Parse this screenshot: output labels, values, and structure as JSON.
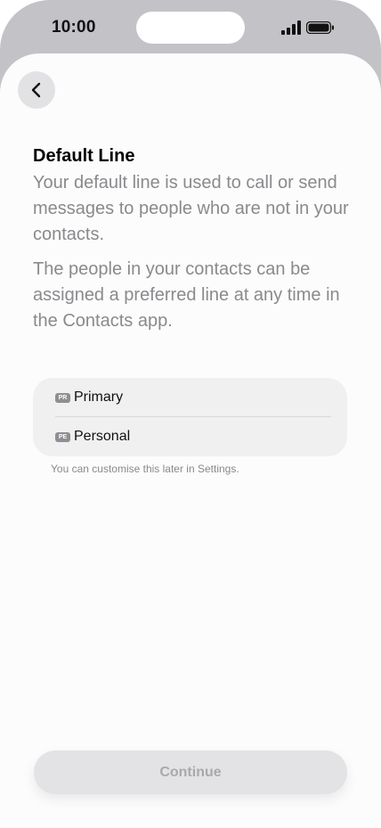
{
  "status_bar": {
    "time": "10:00"
  },
  "nav": {
    "back_icon": "chevron-left-icon"
  },
  "title": "Default Line",
  "description": [
    "Your default line is used to call or send messages to people who are not in your contacts.",
    "The people in your contacts can be assigned a preferred line at any time in the Contacts app."
  ],
  "options": [
    {
      "badge": "PR",
      "label": "Primary"
    },
    {
      "badge": "PE",
      "label": "Personal"
    }
  ],
  "footnote": "You can customise this later in Settings.",
  "continue_button": {
    "label": "Continue",
    "enabled": false
  },
  "colors": {
    "frame": "#c2c2c7",
    "sheet": "#fcfcfc",
    "secondary_text": "#8a8a8e",
    "badge": "#8e8e93",
    "disabled_button": "#e3e3e5"
  }
}
